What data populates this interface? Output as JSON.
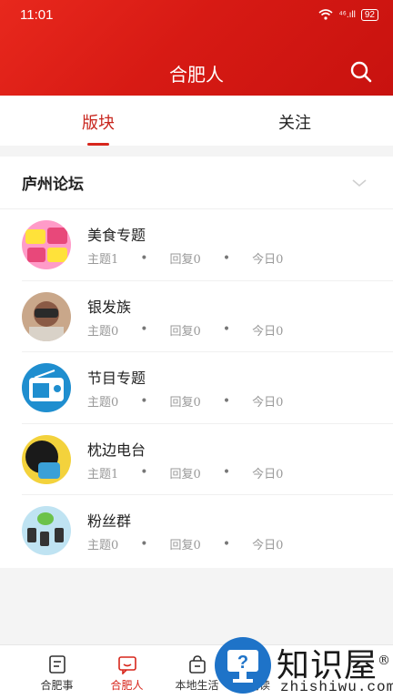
{
  "status_bar": {
    "time": "11:01",
    "signal": "⁴⁶.ıll",
    "battery": "92"
  },
  "header": {
    "title": "合肥人"
  },
  "tabs": [
    {
      "label": "版块",
      "active": true
    },
    {
      "label": "关注",
      "active": false
    }
  ],
  "section": {
    "title": "庐州论坛",
    "forums": [
      {
        "name": "美食专题",
        "topics": "主题1",
        "replies": "回复0",
        "today": "今日0",
        "icon": "food-avatar"
      },
      {
        "name": "银发族",
        "topics": "主题0",
        "replies": "回复0",
        "today": "今日0",
        "icon": "elder-avatar"
      },
      {
        "name": "节目专题",
        "topics": "主题0",
        "replies": "回复0",
        "today": "今日0",
        "icon": "radio-avatar"
      },
      {
        "name": "枕边电台",
        "topics": "主题1",
        "replies": "回复0",
        "today": "今日0",
        "icon": "bedside-radio-avatar"
      },
      {
        "name": "粉丝群",
        "topics": "主题0",
        "replies": "回复0",
        "today": "今日0",
        "icon": "fans-avatar"
      }
    ],
    "dot": "•"
  },
  "bottom_nav": [
    {
      "label": "合肥事",
      "active": false
    },
    {
      "label": "合肥人",
      "active": true
    },
    {
      "label": "本地生活",
      "active": false
    },
    {
      "label": "阅读",
      "active": false
    }
  ],
  "watermark": {
    "text": "知识屋",
    "reg": "®",
    "sub": "zhishiwu.com",
    "glyph": "?"
  },
  "colors": {
    "brand_red": "#d7261c",
    "header_dark": "#c8120f",
    "text_gray": "#999999"
  }
}
